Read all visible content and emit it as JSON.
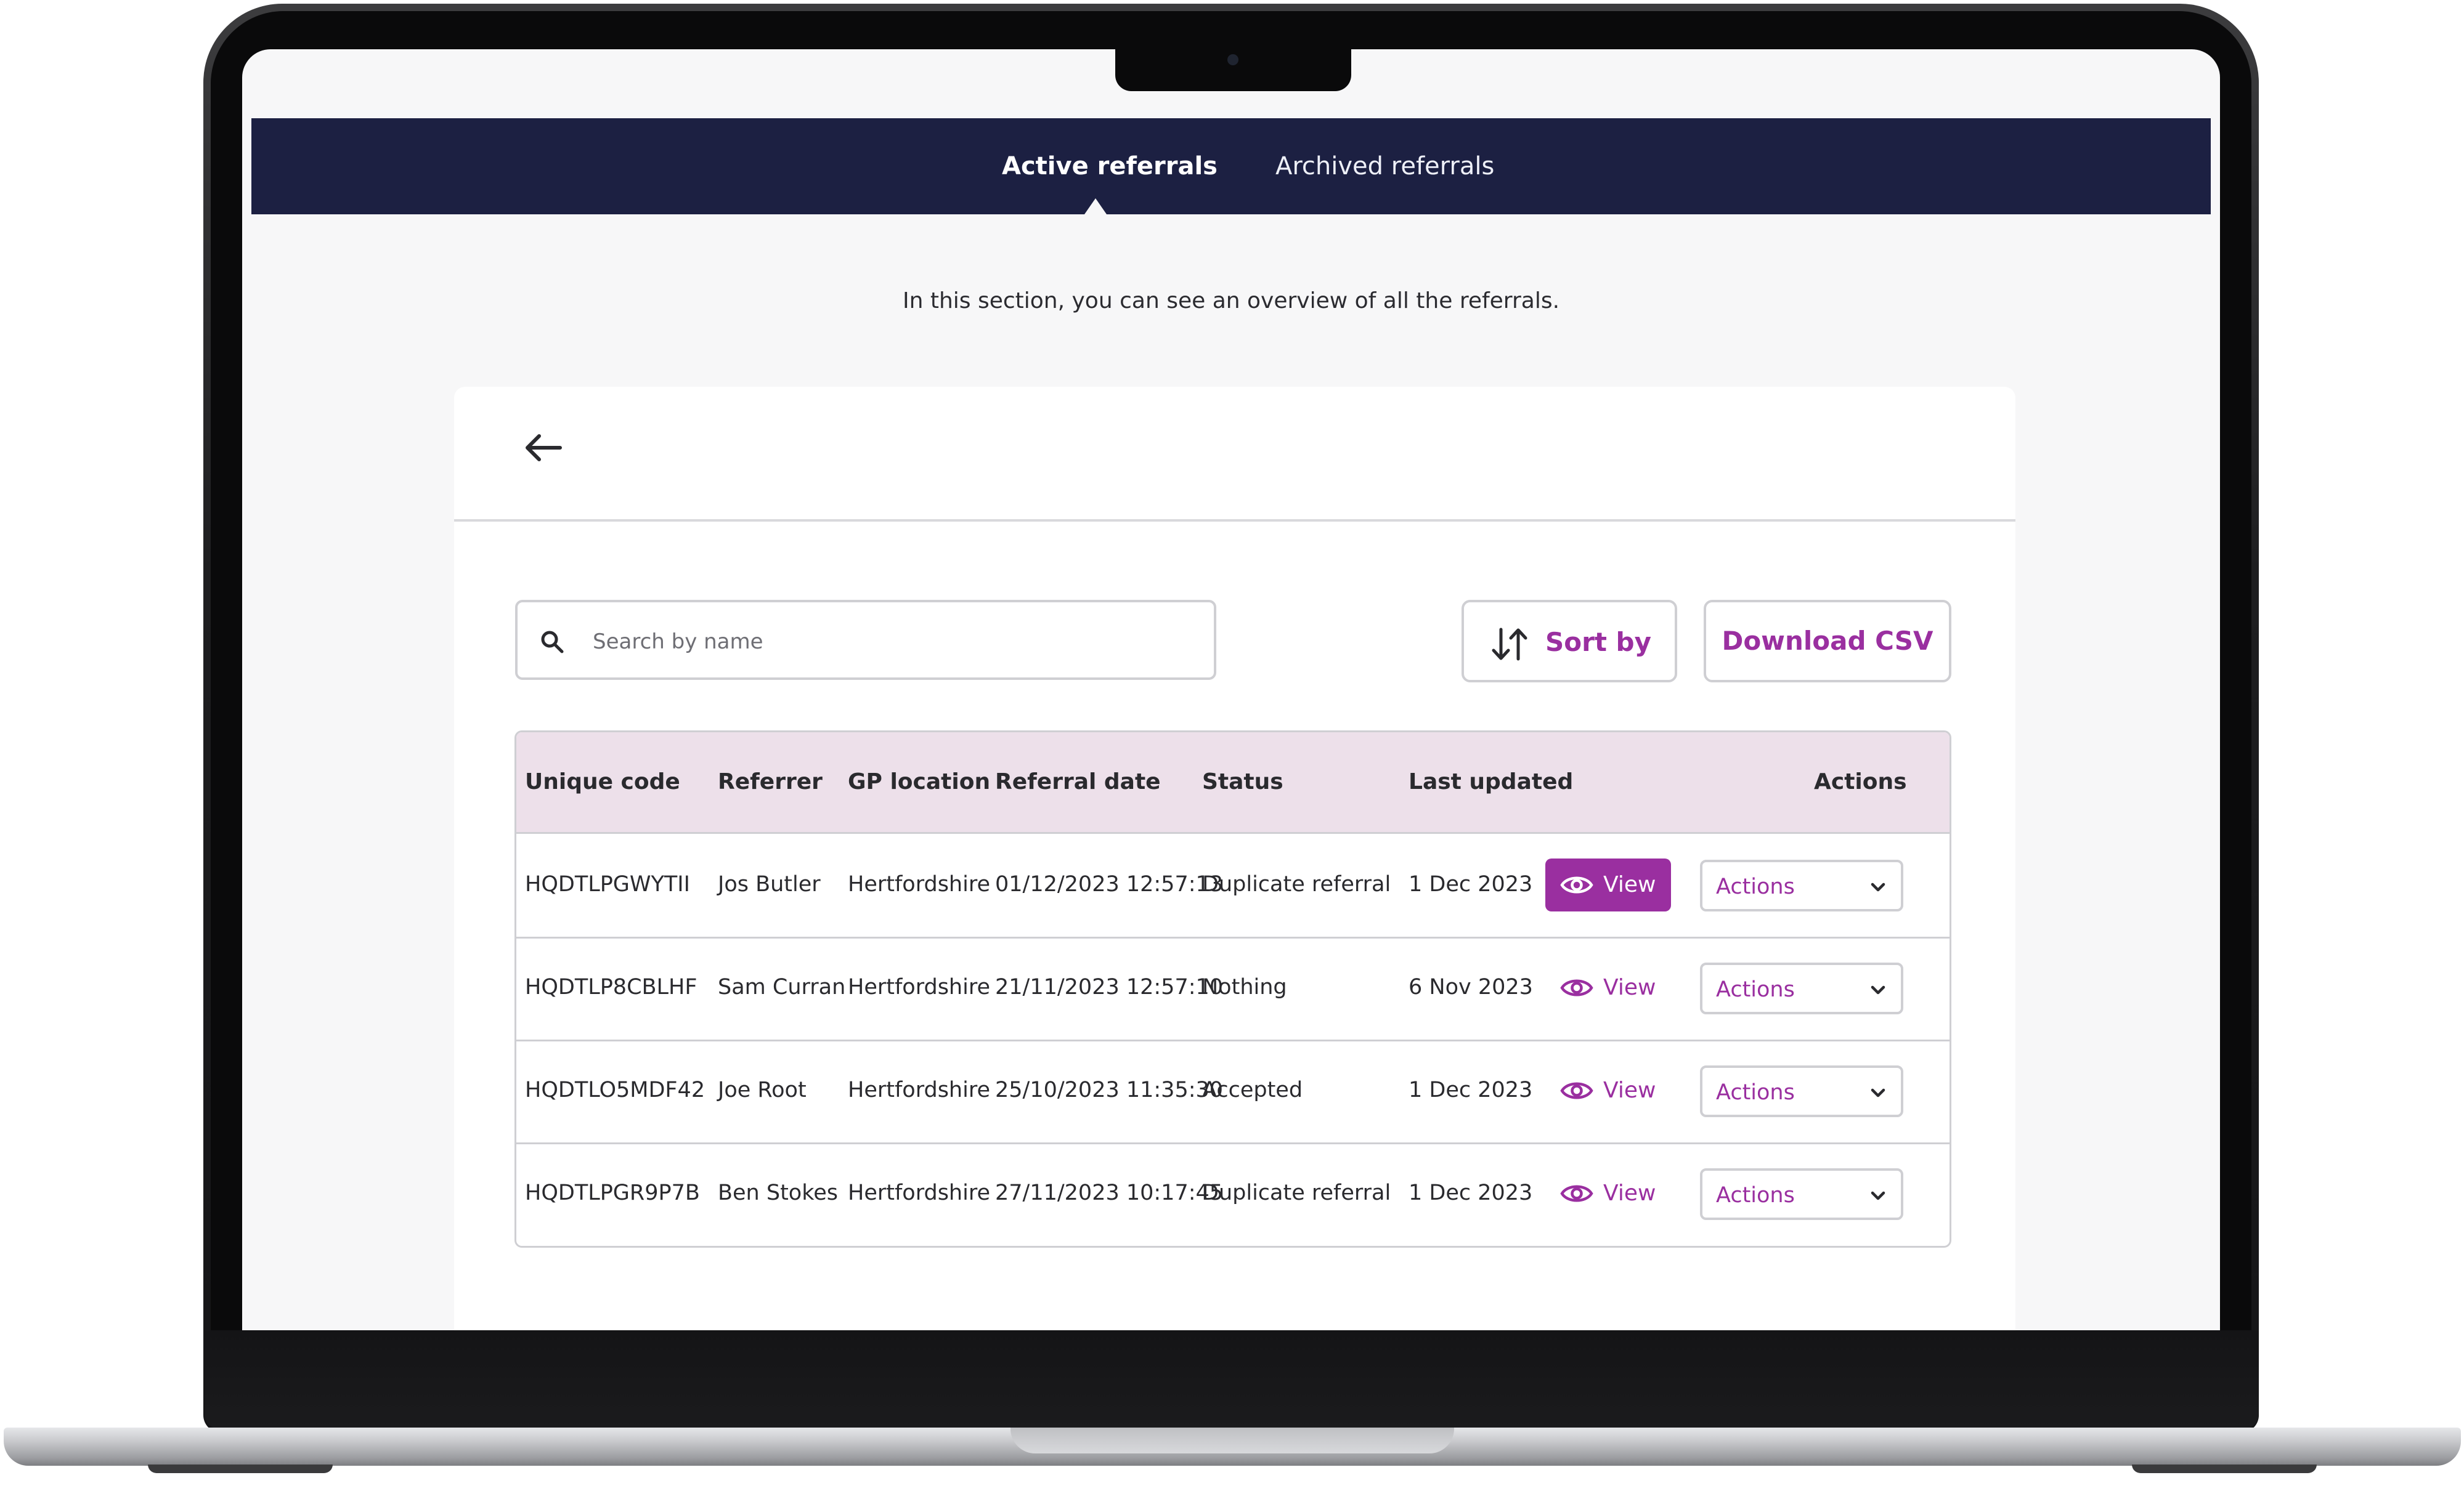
{
  "nav": {
    "tabs": [
      {
        "label": "Active referrals",
        "active": true
      },
      {
        "label": "Archived referrals",
        "active": false
      }
    ]
  },
  "intro_text": "In this section, you can see an overview of all the referrals.",
  "toolbar": {
    "back_icon": "arrow-left-icon",
    "search_placeholder": "Search by name",
    "search_value": "",
    "sort_label": "Sort by",
    "download_label": "Download CSV"
  },
  "table": {
    "columns": [
      "Unique code",
      "Referrer",
      "GP location",
      "Referral date",
      "Status",
      "Last updated",
      "Actions"
    ],
    "rows": [
      {
        "code": "HQDTLPGWYTII",
        "referrer": "Jos Butler",
        "gp": "Hertfordshire",
        "date": "01/12/2023 12:57:13",
        "status": "Duplicate referral",
        "updated": "1 Dec 2023",
        "view": "View",
        "actions": "Actions",
        "highlighted": true
      },
      {
        "code": "HQDTLP8CBLHF",
        "referrer": "Sam Curran",
        "gp": "Hertfordshire",
        "date": "21/11/2023 12:57:10",
        "status": "Nothing",
        "updated": "6 Nov 2023",
        "view": "View",
        "actions": "Actions",
        "highlighted": false
      },
      {
        "code": "HQDTLO5MDF42",
        "referrer": "Joe Root",
        "gp": "Hertfordshire",
        "date": "25/10/2023 11:35:30",
        "status": "Accepted",
        "updated": "1 Dec 2023",
        "view": "View",
        "actions": "Actions",
        "highlighted": false
      },
      {
        "code": "HQDTLPGR9P7B",
        "referrer": "Ben Stokes",
        "gp": "Hertfordshire",
        "date": "27/11/2023 10:17:45",
        "status": "Duplicate referral",
        "updated": "1 Dec 2023",
        "view": "View",
        "actions": "Actions",
        "highlighted": false
      }
    ]
  },
  "colors": {
    "nav_bg": "#1c2042",
    "accent": "#9a2fa0",
    "table_header_bg": "#ede0ea"
  }
}
